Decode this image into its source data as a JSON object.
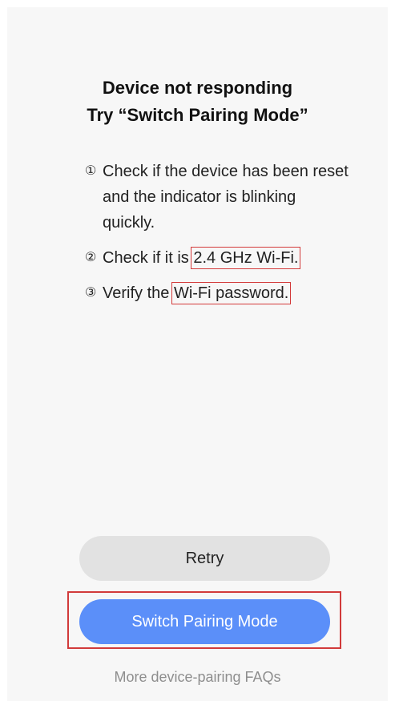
{
  "title_line1": "Device not responding",
  "title_line2": "Try “Switch Pairing Mode”",
  "steps": [
    {
      "num": "①",
      "text_before": "Check if the device has been reset and the indicator is blinking quickly.",
      "highlight": "",
      "text_after": ""
    },
    {
      "num": "②",
      "text_before": "Check if it is ",
      "highlight": "2.4 GHz Wi-Fi.",
      "text_after": ""
    },
    {
      "num": "③",
      "text_before": "Verify the ",
      "highlight": "Wi-Fi password.",
      "text_after": ""
    }
  ],
  "buttons": {
    "retry": "Retry",
    "switch_pairing": "Switch Pairing Mode"
  },
  "faq_link": "More device-pairing FAQs",
  "colors": {
    "primary": "#5b8ff9",
    "secondary_button": "#e2e2e2",
    "highlight_border": "#d13a3a"
  }
}
